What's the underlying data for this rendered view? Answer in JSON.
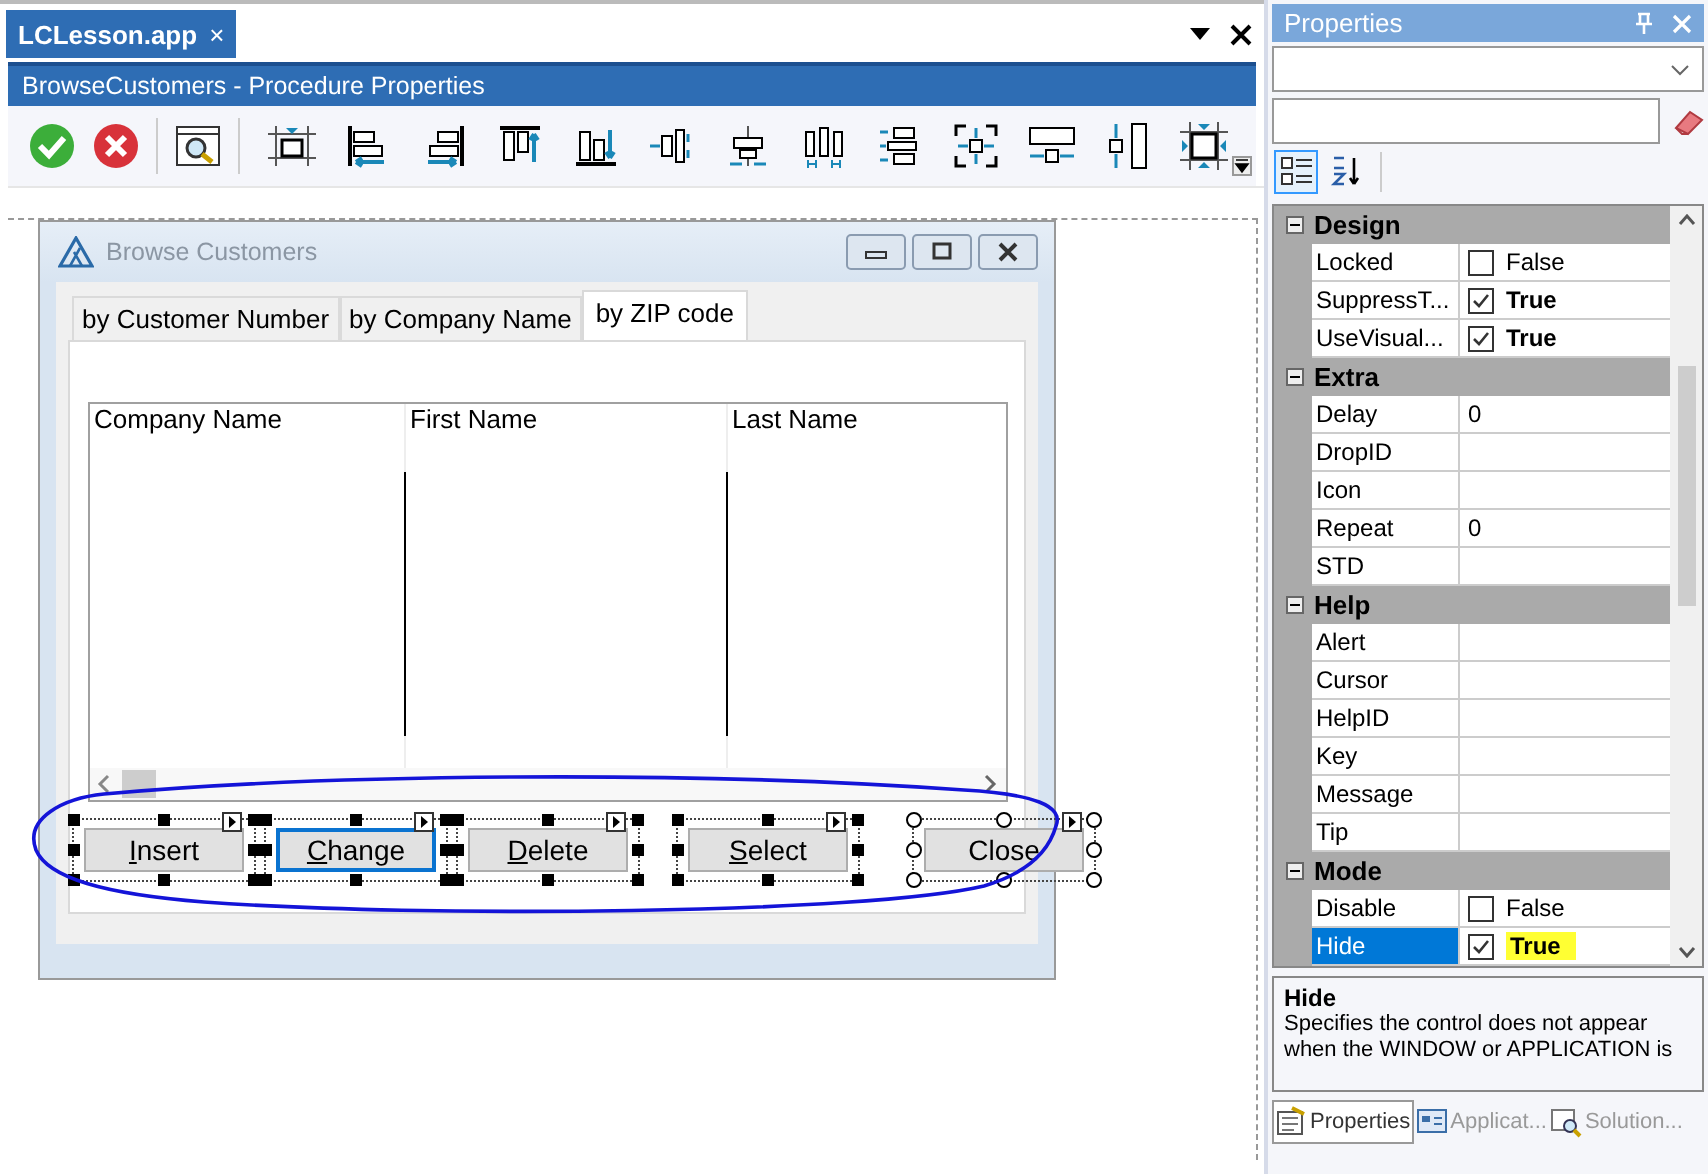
{
  "document_tab": {
    "label": "LCLesson.app",
    "selected": true,
    "close": "×"
  },
  "procedure_title": "BrowseCustomers - Procedure Properties",
  "design_window": {
    "title": "Browse Customers",
    "tabs": [
      {
        "label": "by Customer Number",
        "selected": false
      },
      {
        "label": "by Company Name",
        "selected": false
      },
      {
        "label": "by ZIP code",
        "selected": true
      }
    ],
    "list_columns": [
      "Company Name",
      "First Name",
      "Last Name"
    ],
    "buttons": [
      {
        "label": "Insert",
        "underline_first": true,
        "focused": false,
        "hollow_handles": false
      },
      {
        "label": "Change",
        "underline_first": true,
        "focused": true,
        "hollow_handles": false
      },
      {
        "label": "Delete",
        "underline_first": true,
        "focused": false,
        "hollow_handles": false
      },
      {
        "label": "Select",
        "underline_first": true,
        "focused": false,
        "hollow_handles": false
      },
      {
        "label": "Close",
        "underline_first": false,
        "focused": false,
        "hollow_handles": true
      }
    ]
  },
  "properties": {
    "title": "Properties",
    "view_buttons": [
      {
        "kind": "categorized",
        "selected": true
      },
      {
        "kind": "alphabetical",
        "selected": false
      }
    ],
    "categories": [
      {
        "name": "Design",
        "expanded": true,
        "items": [
          {
            "name": "Locked",
            "kind": "check",
            "checked": false,
            "value": "False",
            "selected": false,
            "highlighted": false
          },
          {
            "name": "SuppressT...",
            "kind": "check",
            "checked": true,
            "value": "True",
            "selected": false,
            "highlighted": false
          },
          {
            "name": "UseVisual...",
            "kind": "check",
            "checked": true,
            "value": "True",
            "selected": false,
            "highlighted": false
          }
        ]
      },
      {
        "name": "Extra",
        "expanded": true,
        "items": [
          {
            "name": "Delay",
            "kind": "text",
            "value": "0",
            "selected": false
          },
          {
            "name": "DropID",
            "kind": "text",
            "selected": false
          },
          {
            "name": "Icon",
            "kind": "text",
            "selected": false
          },
          {
            "name": "Repeat",
            "kind": "text",
            "value": "0",
            "selected": false
          },
          {
            "name": "STD",
            "kind": "text",
            "selected": false
          }
        ]
      },
      {
        "name": "Help",
        "expanded": true,
        "items": [
          {
            "name": "Alert",
            "kind": "text",
            "selected": false
          },
          {
            "name": "Cursor",
            "kind": "text",
            "selected": false
          },
          {
            "name": "HelpID",
            "kind": "text",
            "selected": false
          },
          {
            "name": "Key",
            "kind": "text",
            "selected": false
          },
          {
            "name": "Message",
            "kind": "text",
            "selected": false
          },
          {
            "name": "Tip",
            "kind": "text",
            "selected": false
          }
        ]
      },
      {
        "name": "Mode",
        "expanded": true,
        "items": [
          {
            "name": "Disable",
            "kind": "check",
            "checked": false,
            "value": "False",
            "selected": false,
            "highlighted": false
          },
          {
            "name": "Hide",
            "kind": "check",
            "checked": true,
            "value": "True",
            "selected": true,
            "highlighted": true
          }
        ]
      }
    ],
    "description": {
      "title": "Hide",
      "text": "Specifies the control does not appear when the WINDOW or APPLICATION is"
    },
    "bottom_tabs": [
      {
        "label": "Properties",
        "selected": true
      },
      {
        "label": "Applicat...",
        "selected": false
      },
      {
        "label": "Solution...",
        "selected": false
      }
    ]
  }
}
